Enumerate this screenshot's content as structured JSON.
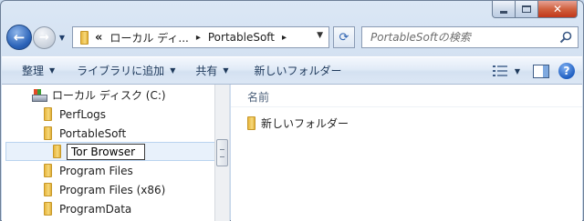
{
  "window": {
    "close_glyph": "✕"
  },
  "nav": {
    "back_glyph": "←",
    "forward_glyph": "→",
    "history_glyph": "▼"
  },
  "address": {
    "overflow_glyph": "«",
    "crumbs": [
      "ローカル ディ...",
      "PortableSoft"
    ],
    "separator": "▸",
    "dropdown_glyph": "▼"
  },
  "refresh_glyph": "⟳",
  "search": {
    "placeholder": "PortableSoftの検索"
  },
  "toolbar": {
    "organize": "整理",
    "include_in_library": "ライブラリに追加",
    "share": "共有",
    "new_folder": "新しいフォルダー",
    "arrow": "▼",
    "help_glyph": "?"
  },
  "tree": {
    "drive": "ローカル ディスク (C:)",
    "items": [
      "PerfLogs",
      "PortableSoft",
      "Program Files",
      "Program Files (x86)",
      "ProgramData"
    ],
    "rename_value": "Tor Browser"
  },
  "content": {
    "column_name": "名前",
    "items": [
      "新しいフォルダー"
    ]
  },
  "colors": {
    "accent": "#2a62b8",
    "close": "#c1371a",
    "folder": "#f0c95a"
  }
}
